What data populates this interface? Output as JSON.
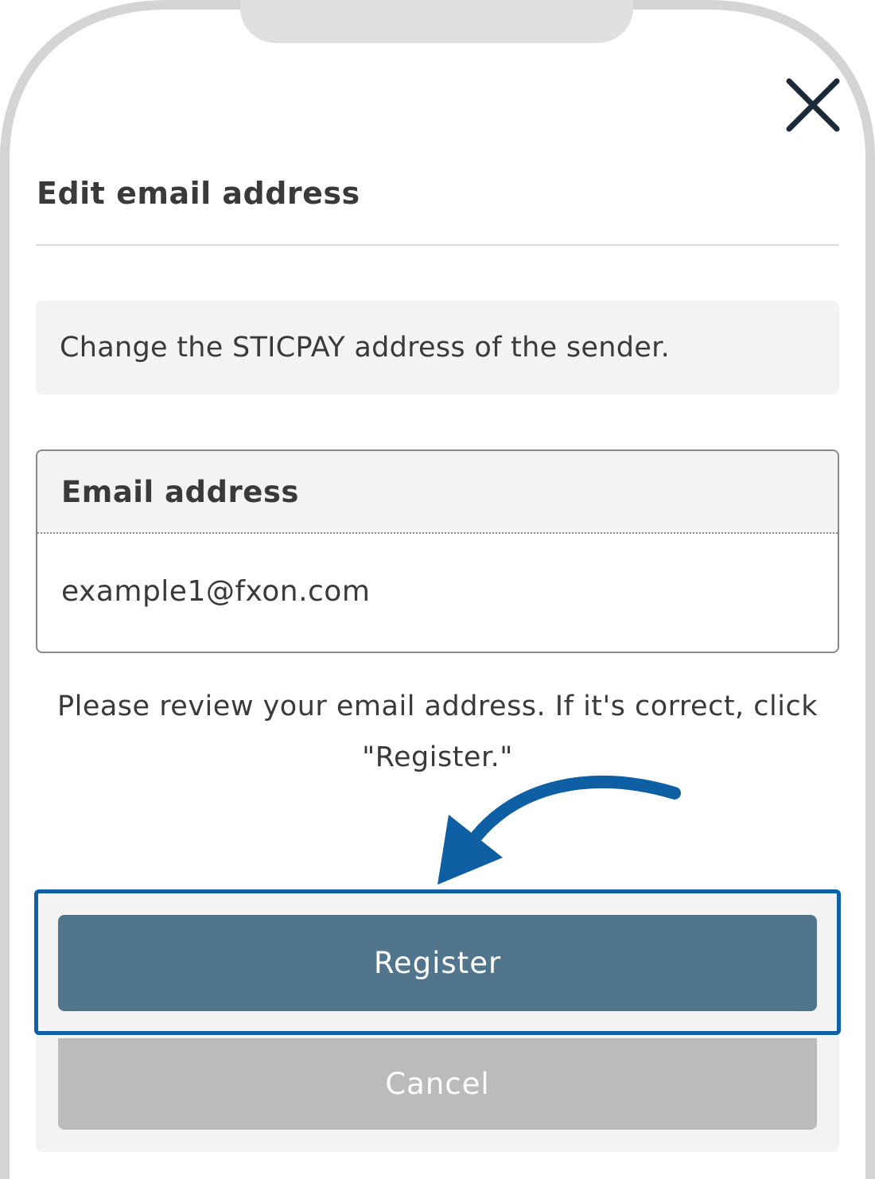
{
  "dialog": {
    "title": "Edit email address",
    "close_icon": "close-icon",
    "info_text": "Change the STICPAY address of the sender.",
    "email_field": {
      "label": "Email address",
      "value": "example1@fxon.com"
    },
    "review_note": "Please review your email address. If it's correct, click \"Register.\"",
    "register_label": "Register",
    "cancel_label": "Cancel"
  },
  "annotation": {
    "arrow_icon": "curved-arrow-icon",
    "color": "#0f5fa5"
  },
  "colors": {
    "register_button": "#50758c",
    "cancel_button": "#bbbbbb",
    "panel_background": "#f3f3f3",
    "text": "#3a3a3a"
  }
}
